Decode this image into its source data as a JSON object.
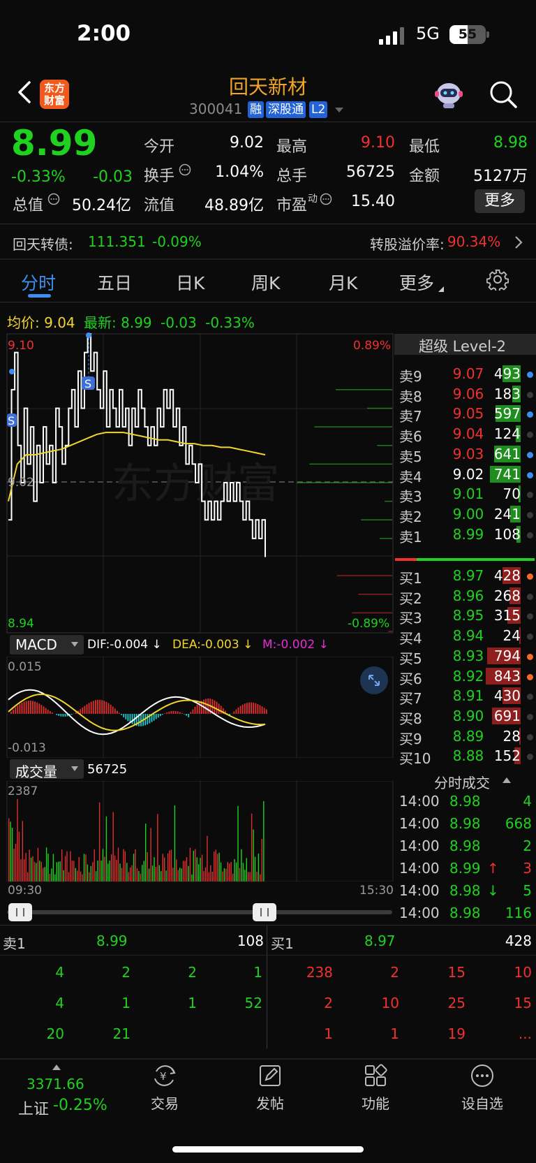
{
  "status_bar": {
    "time": "2:00",
    "network": "5G",
    "battery": "55"
  },
  "header": {
    "logo_text": "东方财富",
    "stock_name": "回天新材",
    "stock_code": "300041",
    "tags": [
      "融",
      "深股通",
      "L2"
    ]
  },
  "quote": {
    "price": "8.99",
    "change_pct": "-0.33%",
    "change": "-0.03",
    "rows": [
      [
        {
          "label": "今开",
          "value": "9.02",
          "color": "white"
        },
        {
          "label": "最高",
          "value": "9.10",
          "color": "red"
        },
        {
          "label": "最低",
          "value": "8.98",
          "color": "green"
        }
      ],
      [
        {
          "label": "换手",
          "value": "1.04%",
          "color": "white"
        },
        {
          "label": "总手",
          "value": "56725",
          "color": "white"
        },
        {
          "label": "金额",
          "value": "5127万",
          "color": "white"
        }
      ]
    ],
    "total_value_label": "总值",
    "total_value": "50.24亿",
    "float_value_label": "流值",
    "float_value": "48.89亿",
    "pe_label": "市盈",
    "pe_sup": "动",
    "pe_value": "15.40",
    "more_button": "更多"
  },
  "bond": {
    "label": "回天转债:",
    "price": "111.351",
    "change": "-0.09%",
    "premium_label": "转股溢价率:",
    "premium_value": "90.34%"
  },
  "tabs": [
    "分时",
    "五日",
    "日K",
    "周K",
    "月K",
    "更多"
  ],
  "active_tab": "分时",
  "intraday": {
    "avg_label": "均价:",
    "avg_value": "9.04",
    "latest_label": "最新:",
    "latest_value": "8.99",
    "latest_change": "-0.03",
    "latest_pct": "-0.33%",
    "y_high": "9.10",
    "y_mid": "9.02",
    "y_low": "8.94",
    "pct_high": "0.89%",
    "pct_low": "-0.89%",
    "watermark": "东方财富",
    "time_start": "09:30",
    "time_end": "15:30"
  },
  "macd": {
    "label": "MACD",
    "dif": "DIF:-0.004 ↓",
    "dea": "DEA:-0.003 ↓",
    "m": "M:-0.002 ↓",
    "y_high": "0.015",
    "y_low": "-0.013"
  },
  "volume": {
    "label": "成交量",
    "value": "56725",
    "y_high": "2387"
  },
  "order_book": {
    "title": "超级 Level-2",
    "asks": [
      {
        "label": "卖9",
        "price": "9.07",
        "price_color": "red",
        "vol": "493",
        "fill": 0.45,
        "dot": "blue"
      },
      {
        "label": "卖8",
        "price": "9.06",
        "price_color": "red",
        "vol": "183",
        "fill": 0.2,
        "dot": "gray"
      },
      {
        "label": "卖7",
        "price": "9.05",
        "price_color": "red",
        "vol": "597",
        "fill": 0.62,
        "dot": "blue"
      },
      {
        "label": "卖6",
        "price": "9.04",
        "price_color": "red",
        "vol": "124",
        "fill": 0.12,
        "dot": "gray"
      },
      {
        "label": "卖5",
        "price": "9.03",
        "price_color": "red",
        "vol": "641",
        "fill": 0.66,
        "dot": "blue"
      },
      {
        "label": "卖4",
        "price": "9.02",
        "price_color": "white",
        "vol": "741",
        "fill": 0.76,
        "dot": "blue"
      },
      {
        "label": "卖3",
        "price": "9.01",
        "price_color": "green",
        "vol": "70",
        "fill": 0.06,
        "dot": "gray"
      },
      {
        "label": "卖2",
        "price": "9.00",
        "price_color": "green",
        "vol": "241",
        "fill": 0.25,
        "dot": "gray"
      },
      {
        "label": "卖1",
        "price": "8.99",
        "price_color": "green",
        "vol": "108",
        "fill": 0.1,
        "dot": "gray"
      }
    ],
    "bids": [
      {
        "label": "买1",
        "price": "8.97",
        "price_color": "green",
        "vol": "428",
        "fill": 0.44,
        "dot": "orange"
      },
      {
        "label": "买2",
        "price": "8.96",
        "price_color": "green",
        "vol": "268",
        "fill": 0.27,
        "dot": "gray"
      },
      {
        "label": "买3",
        "price": "8.95",
        "price_color": "green",
        "vol": "315",
        "fill": 0.32,
        "dot": "gray"
      },
      {
        "label": "买4",
        "price": "8.94",
        "price_color": "green",
        "vol": "24",
        "fill": 0.03,
        "dot": "gray"
      },
      {
        "label": "买5",
        "price": "8.93",
        "price_color": "green",
        "vol": "794",
        "fill": 0.82,
        "dot": "orange"
      },
      {
        "label": "买6",
        "price": "8.92",
        "price_color": "green",
        "vol": "843",
        "fill": 0.87,
        "dot": "orange"
      },
      {
        "label": "买7",
        "price": "8.91",
        "price_color": "green",
        "vol": "430",
        "fill": 0.44,
        "dot": "gray"
      },
      {
        "label": "买8",
        "price": "8.90",
        "price_color": "green",
        "vol": "691",
        "fill": 0.71,
        "dot": "gray"
      },
      {
        "label": "买9",
        "price": "8.89",
        "price_color": "green",
        "vol": "28",
        "fill": 0.03,
        "dot": "gray"
      },
      {
        "label": "买10",
        "price": "8.88",
        "price_color": "green",
        "vol": "152",
        "fill": 0.16,
        "dot": "gray"
      }
    ]
  },
  "ticks": {
    "title": "分时成交",
    "rows": [
      {
        "time": "14:00",
        "price": "8.98",
        "arrow": "",
        "vol": "4",
        "vol_color": "green"
      },
      {
        "time": "14:00",
        "price": "8.98",
        "arrow": "",
        "vol": "668",
        "vol_color": "green"
      },
      {
        "time": "14:00",
        "price": "8.98",
        "arrow": "",
        "vol": "2",
        "vol_color": "green"
      },
      {
        "time": "14:00",
        "price": "8.99",
        "arrow": "↑",
        "vol": "3",
        "vol_color": "red"
      },
      {
        "time": "14:00",
        "price": "8.98",
        "arrow": "↓",
        "vol": "5",
        "vol_color": "green"
      },
      {
        "time": "14:00",
        "price": "8.98",
        "arrow": "",
        "vol": "116",
        "vol_color": "green"
      }
    ]
  },
  "queue": {
    "ask_label": "卖1",
    "ask_price": "8.99",
    "ask_vol": "108",
    "bid_label": "买1",
    "bid_price": "8.97",
    "bid_vol": "428",
    "ask_orders": [
      [
        "4",
        "2",
        "2",
        "1"
      ],
      [
        "4",
        "1",
        "1",
        "52"
      ],
      [
        "20",
        "21",
        "",
        ""
      ]
    ],
    "bid_orders": [
      [
        "238",
        "2",
        "15",
        "10"
      ],
      [
        "2",
        "10",
        "25",
        "15"
      ],
      [
        "1",
        "1",
        "19",
        "..."
      ]
    ]
  },
  "bottom_nav": {
    "index_value": "3371.66",
    "index_name": "上证",
    "index_change": "-0.25%",
    "items": [
      "交易",
      "发帖",
      "功能",
      "设自选"
    ]
  },
  "colors": {
    "up": "#f0312f",
    "down": "#1fd21f",
    "avg": "#f0d52f",
    "accent": "#3d8ef0"
  }
}
